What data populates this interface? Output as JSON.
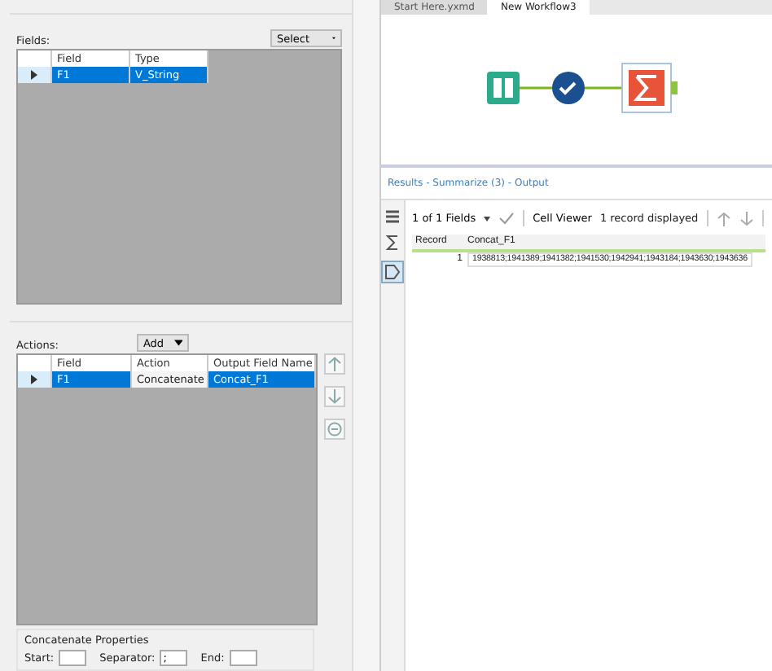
{
  "tabs": [
    {
      "label": "Start Here.yxmd",
      "selected": false
    },
    {
      "label": "New Workflow3",
      "selected": true
    }
  ],
  "config": {
    "fields_label": "Fields:",
    "select_button": "Select",
    "fields_table": {
      "columns": [
        "Field",
        "Type"
      ],
      "rows": [
        {
          "cells": [
            "F1",
            "V_String"
          ],
          "selected": true
        }
      ]
    },
    "actions_label": "Actions:",
    "add_button": "Add",
    "actions_table": {
      "columns": [
        "Field",
        "Action",
        "Output Field Name"
      ],
      "rows": [
        {
          "cells": [
            "F1",
            "Concatenate",
            "Concat_F1"
          ],
          "selected": true
        }
      ]
    },
    "properties": {
      "title": "Concatenate Properties",
      "start_label": "Start:",
      "separator_label": "Separator:",
      "separator_value": ";",
      "end_label": "End:"
    }
  },
  "results": {
    "title": "Results - Summarize (3) - Output",
    "fields_selector": "1 of 1 Fields",
    "cell_viewer": "Cell Viewer",
    "record_count": "1 record displayed",
    "columns": [
      "Record",
      "Concat_F1"
    ],
    "rows": [
      [
        "1",
        "1938813;1941389;1941382;1941530;1942941;1943184;1943630;1943636"
      ]
    ]
  }
}
